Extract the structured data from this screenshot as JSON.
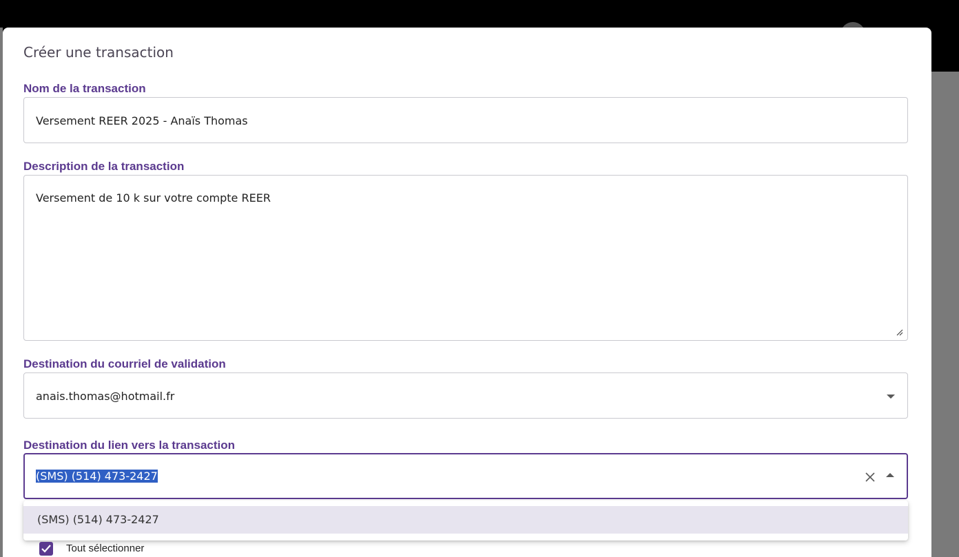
{
  "dialog": {
    "title": "Créer une transaction",
    "fields": {
      "name": {
        "label": "Nom de la transaction",
        "value": "Versement REER 2025 - Anaïs Thomas"
      },
      "description": {
        "label": "Description de la transaction",
        "value": "Versement de 10 k sur votre compte REER"
      },
      "validation_email": {
        "label": "Destination du courriel de validation",
        "value": "anais.thomas@hotmail.fr",
        "icon": "chevron-down-icon"
      },
      "link_destination": {
        "label": "Destination du lien vers la transaction",
        "value": "(SMS) (514) 473-2427",
        "clear_icon": "close-icon",
        "arrow_icon": "chevron-up-icon"
      }
    },
    "dropdown_options": [
      "(SMS) (514) 473-2427"
    ],
    "select_all_label": "Tout sélectionner"
  },
  "colors": {
    "accent": "#5b3a8f",
    "selection": "#2f5fc4",
    "option_highlight": "#e7e4ef"
  }
}
